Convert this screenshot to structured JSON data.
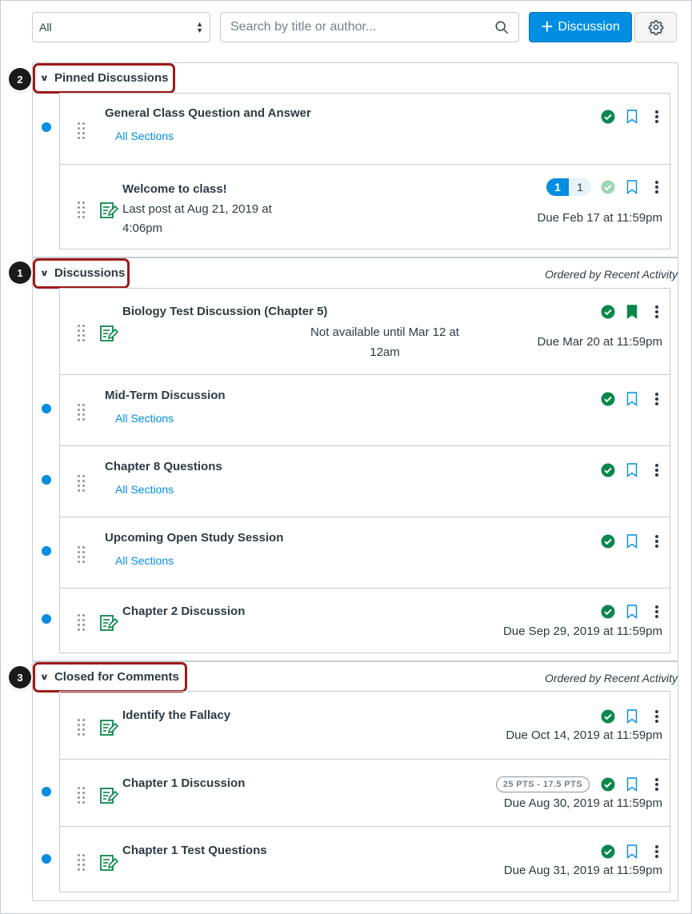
{
  "toolbar": {
    "filter_value": "All",
    "search_placeholder": "Search by title or author...",
    "add_button_label": "Discussion",
    "colors": {
      "primary": "#008ee2",
      "success": "#0b874b",
      "callout_border": "#9e1a1a"
    }
  },
  "sections": {
    "pinned": {
      "title": "Pinned Discussions",
      "callout": "2",
      "rows": [
        {
          "title": "General Class Question and Answer",
          "sections_label": "All Sections"
        },
        {
          "title": "Welcome to class!",
          "last_post": "Last post at Aug 21, 2019 at 4:06pm",
          "unread_count": "1",
          "total_count": "1",
          "due": "Due Feb 17 at 11:59pm"
        }
      ]
    },
    "discussions": {
      "title": "Discussions",
      "callout": "1",
      "ordered": "Ordered by Recent Activity",
      "rows": [
        {
          "title": "Biology Test Discussion (Chapter 5)",
          "availability": "Not available until Mar 12 at 12am",
          "due": "Due Mar 20 at 11:59pm"
        },
        {
          "title": "Mid-Term Discussion",
          "sections_label": "All Sections"
        },
        {
          "title": "Chapter 8 Questions",
          "sections_label": "All Sections"
        },
        {
          "title": "Upcoming Open Study Session",
          "sections_label": "All Sections"
        },
        {
          "title": "Chapter 2 Discussion",
          "due": "Due Sep 29, 2019 at 11:59pm"
        }
      ]
    },
    "closed": {
      "title": "Closed for Comments",
      "callout": "3",
      "ordered": "Ordered by Recent Activity",
      "rows": [
        {
          "title": "Identify the Fallacy",
          "due": "Due Oct 14, 2019 at 11:59pm"
        },
        {
          "title": "Chapter 1 Discussion",
          "points": "25 PTS - 17.5 PTS",
          "due": "Due Aug 30, 2019 at 11:59pm"
        },
        {
          "title": "Chapter 1 Test Questions",
          "due": "Due Aug 31, 2019 at 11:59pm"
        }
      ]
    }
  }
}
